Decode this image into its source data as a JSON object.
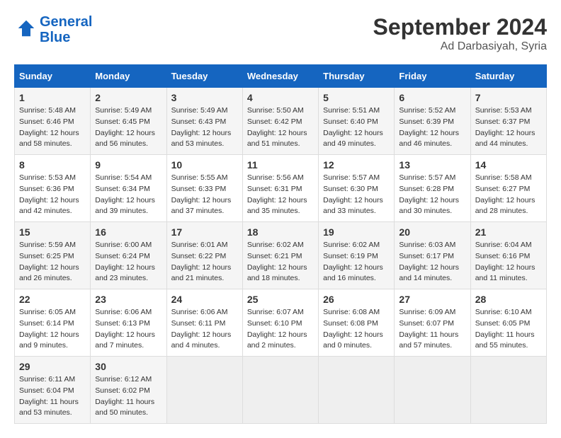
{
  "header": {
    "logo_line1": "General",
    "logo_line2": "Blue",
    "month_title": "September 2024",
    "location": "Ad Darbasiyah, Syria"
  },
  "days_of_week": [
    "Sunday",
    "Monday",
    "Tuesday",
    "Wednesday",
    "Thursday",
    "Friday",
    "Saturday"
  ],
  "weeks": [
    [
      {
        "day": 1,
        "sunrise": "5:48 AM",
        "sunset": "6:46 PM",
        "daylight": "12 hours and 58 minutes."
      },
      {
        "day": 2,
        "sunrise": "5:49 AM",
        "sunset": "6:45 PM",
        "daylight": "12 hours and 56 minutes."
      },
      {
        "day": 3,
        "sunrise": "5:49 AM",
        "sunset": "6:43 PM",
        "daylight": "12 hours and 53 minutes."
      },
      {
        "day": 4,
        "sunrise": "5:50 AM",
        "sunset": "6:42 PM",
        "daylight": "12 hours and 51 minutes."
      },
      {
        "day": 5,
        "sunrise": "5:51 AM",
        "sunset": "6:40 PM",
        "daylight": "12 hours and 49 minutes."
      },
      {
        "day": 6,
        "sunrise": "5:52 AM",
        "sunset": "6:39 PM",
        "daylight": "12 hours and 46 minutes."
      },
      {
        "day": 7,
        "sunrise": "5:53 AM",
        "sunset": "6:37 PM",
        "daylight": "12 hours and 44 minutes."
      }
    ],
    [
      {
        "day": 8,
        "sunrise": "5:53 AM",
        "sunset": "6:36 PM",
        "daylight": "12 hours and 42 minutes."
      },
      {
        "day": 9,
        "sunrise": "5:54 AM",
        "sunset": "6:34 PM",
        "daylight": "12 hours and 39 minutes."
      },
      {
        "day": 10,
        "sunrise": "5:55 AM",
        "sunset": "6:33 PM",
        "daylight": "12 hours and 37 minutes."
      },
      {
        "day": 11,
        "sunrise": "5:56 AM",
        "sunset": "6:31 PM",
        "daylight": "12 hours and 35 minutes."
      },
      {
        "day": 12,
        "sunrise": "5:57 AM",
        "sunset": "6:30 PM",
        "daylight": "12 hours and 33 minutes."
      },
      {
        "day": 13,
        "sunrise": "5:57 AM",
        "sunset": "6:28 PM",
        "daylight": "12 hours and 30 minutes."
      },
      {
        "day": 14,
        "sunrise": "5:58 AM",
        "sunset": "6:27 PM",
        "daylight": "12 hours and 28 minutes."
      }
    ],
    [
      {
        "day": 15,
        "sunrise": "5:59 AM",
        "sunset": "6:25 PM",
        "daylight": "12 hours and 26 minutes."
      },
      {
        "day": 16,
        "sunrise": "6:00 AM",
        "sunset": "6:24 PM",
        "daylight": "12 hours and 23 minutes."
      },
      {
        "day": 17,
        "sunrise": "6:01 AM",
        "sunset": "6:22 PM",
        "daylight": "12 hours and 21 minutes."
      },
      {
        "day": 18,
        "sunrise": "6:02 AM",
        "sunset": "6:21 PM",
        "daylight": "12 hours and 18 minutes."
      },
      {
        "day": 19,
        "sunrise": "6:02 AM",
        "sunset": "6:19 PM",
        "daylight": "12 hours and 16 minutes."
      },
      {
        "day": 20,
        "sunrise": "6:03 AM",
        "sunset": "6:17 PM",
        "daylight": "12 hours and 14 minutes."
      },
      {
        "day": 21,
        "sunrise": "6:04 AM",
        "sunset": "6:16 PM",
        "daylight": "12 hours and 11 minutes."
      }
    ],
    [
      {
        "day": 22,
        "sunrise": "6:05 AM",
        "sunset": "6:14 PM",
        "daylight": "12 hours and 9 minutes."
      },
      {
        "day": 23,
        "sunrise": "6:06 AM",
        "sunset": "6:13 PM",
        "daylight": "12 hours and 7 minutes."
      },
      {
        "day": 24,
        "sunrise": "6:06 AM",
        "sunset": "6:11 PM",
        "daylight": "12 hours and 4 minutes."
      },
      {
        "day": 25,
        "sunrise": "6:07 AM",
        "sunset": "6:10 PM",
        "daylight": "12 hours and 2 minutes."
      },
      {
        "day": 26,
        "sunrise": "6:08 AM",
        "sunset": "6:08 PM",
        "daylight": "12 hours and 0 minutes."
      },
      {
        "day": 27,
        "sunrise": "6:09 AM",
        "sunset": "6:07 PM",
        "daylight": "11 hours and 57 minutes."
      },
      {
        "day": 28,
        "sunrise": "6:10 AM",
        "sunset": "6:05 PM",
        "daylight": "11 hours and 55 minutes."
      }
    ],
    [
      {
        "day": 29,
        "sunrise": "6:11 AM",
        "sunset": "6:04 PM",
        "daylight": "11 hours and 53 minutes."
      },
      {
        "day": 30,
        "sunrise": "6:12 AM",
        "sunset": "6:02 PM",
        "daylight": "11 hours and 50 minutes."
      },
      null,
      null,
      null,
      null,
      null
    ]
  ]
}
